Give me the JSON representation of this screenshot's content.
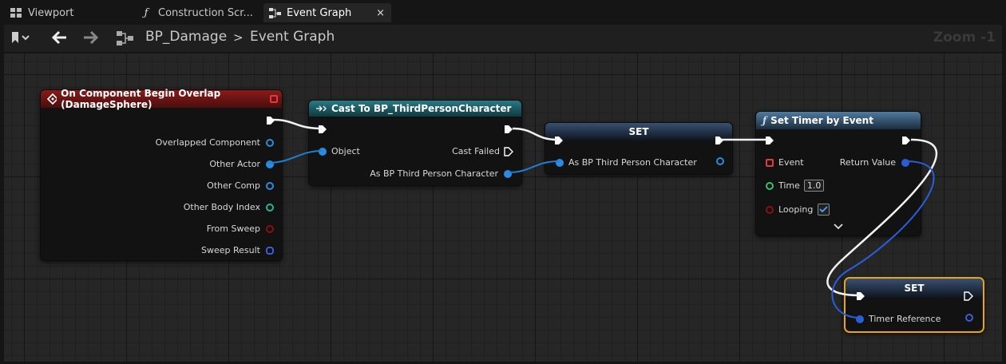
{
  "tabs": [
    {
      "label": "Viewport",
      "icon": "viewport-grid-icon"
    },
    {
      "label": "Construction Scr...",
      "icon": "function-icon"
    },
    {
      "label": "Event Graph",
      "icon": "graph-icon",
      "close": "×"
    }
  ],
  "toolbar": {
    "breadcrumb_root": "BP_Damage",
    "separator": ">",
    "breadcrumb_current": "Event Graph",
    "zoom": "Zoom -1"
  },
  "nodes": {
    "overlap": {
      "title": "On Component Begin Overlap (DamageSphere)",
      "pins": [
        "Overlapped Component",
        "Other Actor",
        "Other Comp",
        "Other Body Index",
        "From Sweep",
        "Sweep Result"
      ]
    },
    "cast": {
      "title": "Cast To BP_ThirdPersonCharacter",
      "object": "Object",
      "cast_failed": "Cast Failed",
      "as_char": "As BP Third Person Character"
    },
    "set1": {
      "title": "SET",
      "pin": "As BP Third Person Character"
    },
    "timer": {
      "title": "Set Timer by Event",
      "event": "Event",
      "return_value": "Return Value",
      "time": "Time",
      "time_value": "1.0",
      "looping": "Looping",
      "looping_value": true
    },
    "set2": {
      "title": "SET",
      "pin": "Timer Reference"
    }
  },
  "colors": {
    "event_header": "#7a1414",
    "cast_header": "#1d5f6a",
    "func_header": "#3a6a8c",
    "object_pin": "#2a8be0",
    "selection": "#e8a516"
  }
}
